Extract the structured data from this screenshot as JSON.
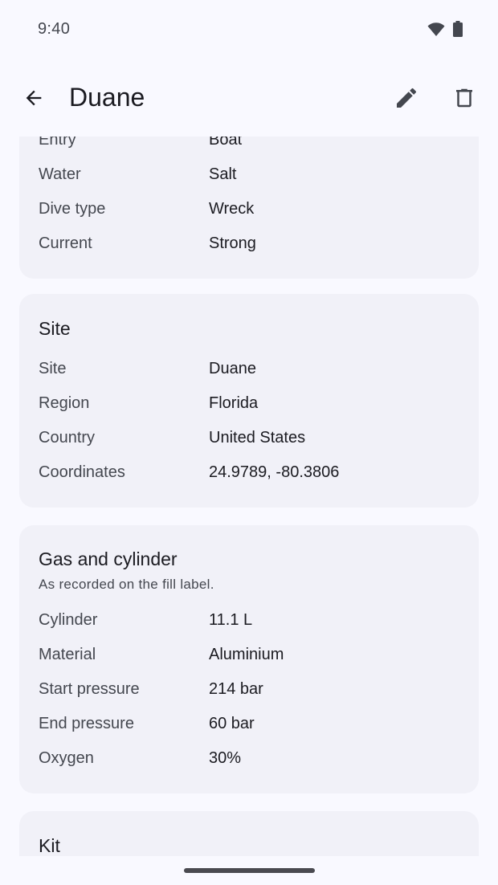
{
  "status_bar": {
    "time": "9:40",
    "icons": [
      "wifi-icon",
      "battery-icon"
    ]
  },
  "app_bar": {
    "title": "Duane",
    "back_icon": "arrow-back-icon",
    "edit_icon": "pencil-icon",
    "delete_icon": "trash-icon"
  },
  "conditions_card": {
    "rows": [
      {
        "label": "Entry",
        "value": "Boat"
      },
      {
        "label": "Water",
        "value": "Salt"
      },
      {
        "label": "Dive type",
        "value": "Wreck"
      },
      {
        "label": "Current",
        "value": "Strong"
      }
    ]
  },
  "site_card": {
    "title": "Site",
    "rows": [
      {
        "label": "Site",
        "value": "Duane"
      },
      {
        "label": "Region",
        "value": "Florida"
      },
      {
        "label": "Country",
        "value": "United States"
      },
      {
        "label": "Coordinates",
        "value": "24.9789, -80.3806"
      }
    ]
  },
  "gas_card": {
    "title": "Gas and cylinder",
    "subtitle": "As recorded on the fill label.",
    "rows": [
      {
        "label": "Cylinder",
        "value": "11.1 L"
      },
      {
        "label": "Material",
        "value": "Aluminium"
      },
      {
        "label": "Start pressure",
        "value": "214 bar"
      },
      {
        "label": "End pressure",
        "value": "60 bar"
      },
      {
        "label": "Oxygen",
        "value": "30%"
      }
    ]
  },
  "kit_card": {
    "title": "Kit"
  },
  "colors": {
    "background": "#f9f9ff",
    "card": "#f1f1f8",
    "text_primary": "#1b1b21",
    "text_secondary": "#44474f"
  }
}
